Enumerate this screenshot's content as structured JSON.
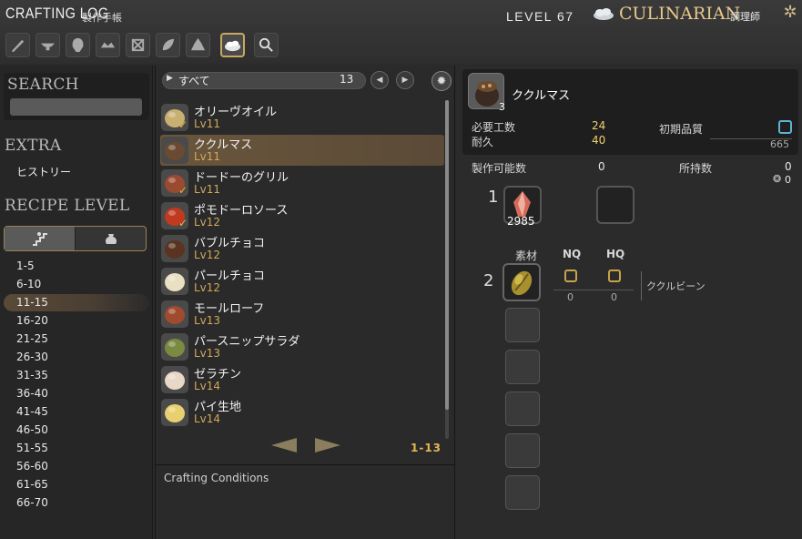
{
  "header": {
    "title": "CRAFTING LOG",
    "title_jp": "製作手帳",
    "level": "LEVEL 67",
    "job_name": "CULINARIAN",
    "job_jp": "調理師"
  },
  "class_tabs": [
    {
      "icon": "carpenter-icon"
    },
    {
      "icon": "blacksmith-icon"
    },
    {
      "icon": "armorer-icon"
    },
    {
      "icon": "goldsmith-icon"
    },
    {
      "icon": "leatherworker-icon"
    },
    {
      "icon": "weaver-icon"
    },
    {
      "icon": "alchemist-icon"
    },
    {
      "icon": "culinarian-icon",
      "active": true
    },
    {
      "icon": "search-icon"
    }
  ],
  "sidebar": {
    "search_heading": "SEARCH",
    "extra_heading": "EXTRA",
    "history": "ヒストリー",
    "recipe_level_heading": "RECIPE LEVEL",
    "levels": [
      "1-5",
      "6-10",
      "11-15",
      "16-20",
      "21-25",
      "26-30",
      "31-35",
      "36-40",
      "41-45",
      "46-50",
      "51-55",
      "56-60",
      "61-65",
      "66-70"
    ],
    "selected_level": "11-15"
  },
  "list": {
    "filter_label": "すべて",
    "filter_count": "13",
    "page_indicator": "1-13",
    "conditions_label": "Crafting Conditions",
    "recipes": [
      {
        "name": "オリーヴオイル",
        "level": "Lv11",
        "checked": true,
        "icon": "olive-oil-icon",
        "color": "#c8b070"
      },
      {
        "name": "ククルマス",
        "level": "Lv11",
        "checked": false,
        "selected": true,
        "icon": "kukuru-mass-icon",
        "color": "#6a4a30"
      },
      {
        "name": "ドードーのグリル",
        "level": "Lv11",
        "checked": true,
        "icon": "grilled-dodo-icon",
        "color": "#9a4a30"
      },
      {
        "name": "ポモドーロソース",
        "level": "Lv12",
        "checked": true,
        "icon": "pomodoro-sauce-icon",
        "color": "#c03a20"
      },
      {
        "name": "バブルチョコ",
        "level": "Lv12",
        "checked": false,
        "icon": "bubble-chocolate-icon",
        "color": "#5a3420"
      },
      {
        "name": "パールチョコ",
        "level": "Lv12",
        "checked": false,
        "icon": "pearl-chocolate-icon",
        "color": "#e8e0c0"
      },
      {
        "name": "モールローフ",
        "level": "Lv13",
        "checked": false,
        "icon": "mole-loaf-icon",
        "color": "#a04a30"
      },
      {
        "name": "パースニップサラダ",
        "level": "Lv13",
        "checked": false,
        "icon": "parsnip-salad-icon",
        "color": "#7a8a40"
      },
      {
        "name": "ゼラチン",
        "level": "Lv14",
        "checked": false,
        "icon": "gelatin-icon",
        "color": "#e8d8c8"
      },
      {
        "name": "パイ生地",
        "level": "Lv14",
        "checked": false,
        "icon": "pie-dough-icon",
        "color": "#e8d070"
      }
    ]
  },
  "detail": {
    "item_name": "ククルマス",
    "yield": "3",
    "progress_label": "必要工数",
    "progress_value": "24",
    "durability_label": "耐久",
    "durability_value": "40",
    "initial_quality_label": "初期品質",
    "initial_quality_value": "665",
    "craftable_label": "製作可能数",
    "craftable_value": "0",
    "owned_label": "所持数",
    "owned_value": "0",
    "owned_hq_value": "0",
    "crystal_count_label": "1",
    "crystal_qty": "2985",
    "material_label": "素材",
    "nq_label": "NQ",
    "hq_label": "HQ",
    "material_count_label": "2",
    "material_name": "ククルビーン",
    "material_nq": "0",
    "material_hq": "0"
  }
}
